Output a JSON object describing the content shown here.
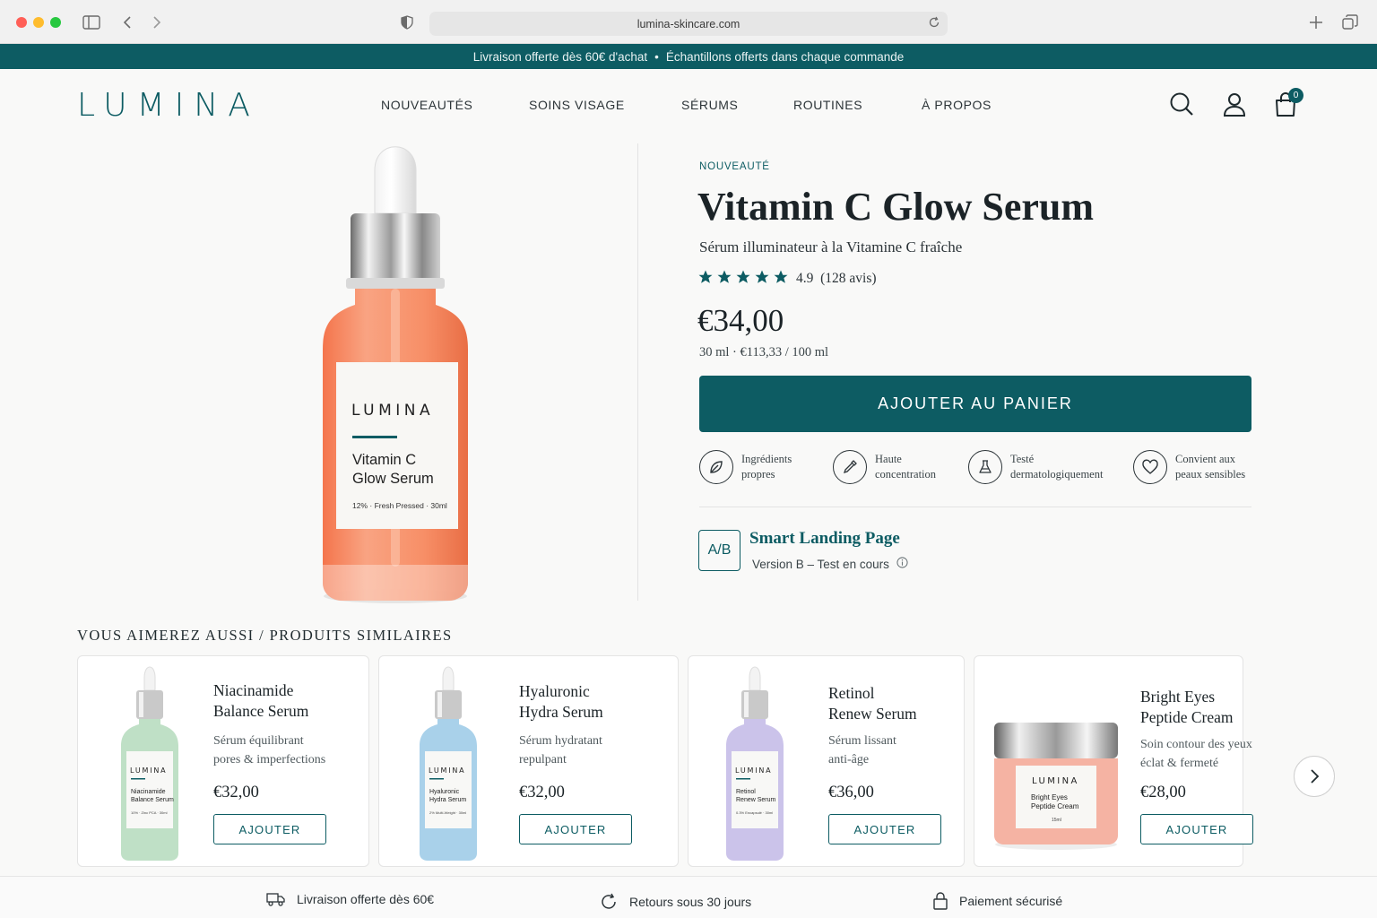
{
  "browser": {
    "url": "lumina-skincare.com"
  },
  "promo": {
    "left": "Livraison offerte dès 60€ d'achat",
    "separator": "•",
    "right": "Échantillons offerts dans chaque commande"
  },
  "header": {
    "logo": "LUMINA",
    "nav": [
      "NOUVEAUTÉS",
      "SOINS VISAGE",
      "SÉRUMS",
      "ROUTINES",
      "À PROPOS"
    ],
    "cart_count": "0",
    "icons": [
      "search-icon",
      "account-icon",
      "cart-icon"
    ]
  },
  "product": {
    "badge": "NOUVEAUTÉ",
    "title": "Vitamin C Glow Serum",
    "subtitle": "Sérum illuminateur à la Vitamine C fraîche",
    "rating": 4.9,
    "rating_text": "4.9",
    "reviews": "(128 avis)",
    "price": "€34,00",
    "unit_price": "30 ml · €113,33 / 100 ml",
    "cta": "AJOUTER AU PANIER",
    "image_label": {
      "brand": "LUMINA",
      "name_line1": "Vitamin C",
      "name_line2": "Glow Serum",
      "detail": "12% · Fresh Pressed · 30ml"
    },
    "features": [
      {
        "icon": "leaf-icon",
        "line1": "Ingrédients",
        "line2": "propres"
      },
      {
        "icon": "dropper-icon",
        "line1": "Haute",
        "line2": "concentration"
      },
      {
        "icon": "flask-icon",
        "line1": "Testé",
        "line2": "dermatologiquement"
      },
      {
        "icon": "heart-icon",
        "line1": "Convient aux",
        "line2": "peaux sensibles"
      }
    ],
    "colors": {
      "accent": "#0d5c63",
      "serum": "#f4875f"
    }
  },
  "ab_test": {
    "badge": "A/B",
    "title": "Smart Landing Page",
    "subtitle": "Version B – Test en cours"
  },
  "similar": {
    "title": "VOUS AIMEREZ AUSSI / PRODUITS SIMILAIRES",
    "items": [
      {
        "name_line1": "Niacinamide",
        "name_line2": "Balance Serum",
        "desc_line1": "Sérum équilibrant",
        "desc_line2": "pores & imperfections",
        "price": "€32,00",
        "button": "AJOUTER",
        "label_name1": "Niacinamide",
        "label_name2": "Balance Serum",
        "label_detail": "10% · Zinc PCA · 30ml",
        "color": "#bfe0c6"
      },
      {
        "name_line1": "Hyaluronic",
        "name_line2": "Hydra Serum",
        "desc_line1": "Sérum hydratant",
        "desc_line2": "repulpant",
        "price": "€32,00",
        "button": "AJOUTER",
        "label_name1": "Hyaluronic",
        "label_name2": "Hydra Serum",
        "label_detail": "2% Multi-Weight · 30ml",
        "color": "#a9d1ea"
      },
      {
        "name_line1": "Retinol",
        "name_line2": "Renew Serum",
        "desc_line1": "Sérum lissant",
        "desc_line2": "anti-âge",
        "price": "€36,00",
        "button": "AJOUTER",
        "label_name1": "Retinol",
        "label_name2": "Renew Serum",
        "label_detail": "0.3% Encapsulé · 30ml",
        "color": "#cbc3ea"
      },
      {
        "name_line1": "Bright Eyes",
        "name_line2": "Peptide Cream",
        "desc_line1": "Soin contour des yeux",
        "desc_line2": "éclat & fermeté",
        "price": "€28,00",
        "button": "AJOUTER",
        "label_name1": "Bright Eyes",
        "label_name2": "Peptide Cream",
        "label_detail": "15ml",
        "color": "#f5b3a3"
      }
    ],
    "brand": "LUMINA"
  },
  "footer": {
    "items": [
      {
        "icon": "truck-icon",
        "label": "Livraison offerte dès 60€"
      },
      {
        "icon": "returns-icon",
        "label": "Retours sous 30 jours"
      },
      {
        "icon": "lock-icon",
        "label": "Paiement sécurisé"
      }
    ]
  }
}
